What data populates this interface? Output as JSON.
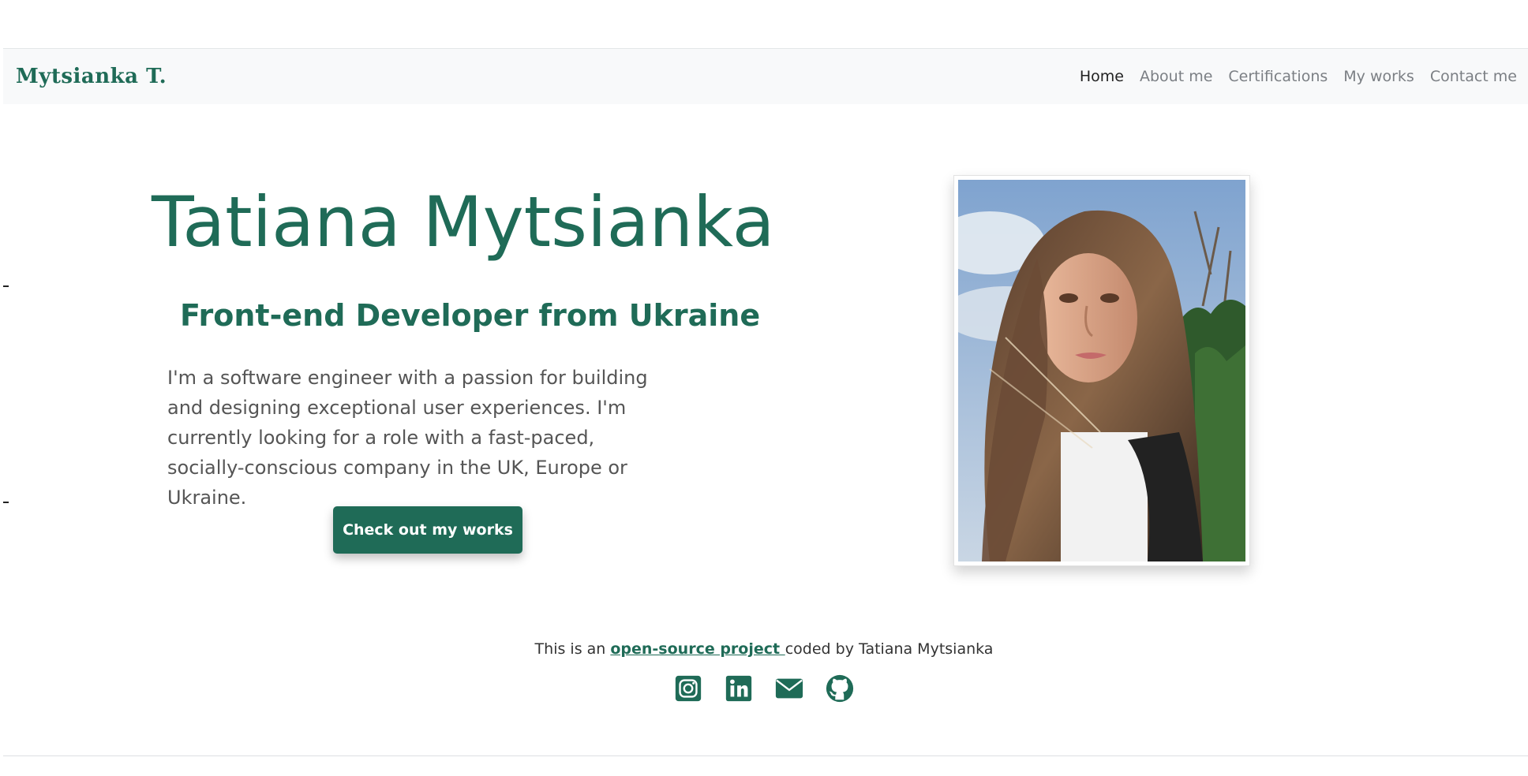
{
  "navbar": {
    "brand": "Mytsianka T.",
    "links": [
      "Home",
      "About me",
      "Certifications",
      "My works",
      "Contact me"
    ]
  },
  "hero": {
    "title": "Tatiana Mytsianka",
    "subtitle": "Front-end Developer from Ukraine",
    "description": "I'm a software engineer with a passion for building and designing exceptional user experiences. I'm currently looking for a role with a fast-paced, socially-conscious company in the UK, Europe or Ukraine.",
    "cta_label": "Check out my works"
  },
  "footer": {
    "prefix": "This is an ",
    "link_text": "open-source project ",
    "suffix": "coded by Tatiana Mytsianka",
    "socials": [
      "instagram-icon",
      "linkedin-icon",
      "mail-icon",
      "github-icon"
    ]
  },
  "colors": {
    "brand": "#1f6b57",
    "navbar_bg": "#f8f9fa",
    "nav_text": "#7b7f84"
  }
}
